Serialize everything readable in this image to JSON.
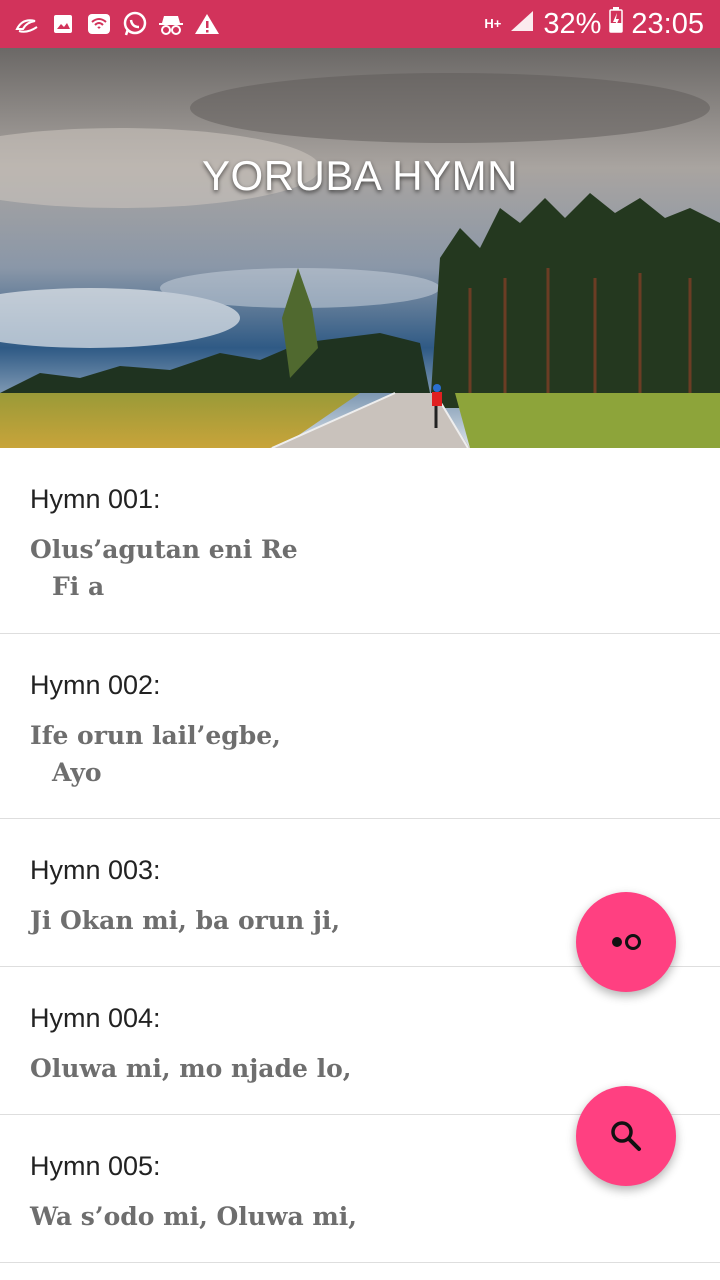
{
  "status_bar": {
    "network": "H+",
    "battery": "32%",
    "time": "23:05"
  },
  "header": {
    "title": "YORUBA HYMN"
  },
  "hymns": [
    {
      "number": "Hymn 001:",
      "line1": "Olus’agutan eni Re",
      "line2": "Fi a"
    },
    {
      "number": "Hymn 002:",
      "line1": "Ife orun lail’egbe,",
      "line2": "Ayo"
    },
    {
      "number": "Hymn 003:",
      "line1": "Ji Okan mi, ba orun ji,",
      "line2": ""
    },
    {
      "number": "Hymn 004:",
      "line1": "Oluwa mi, mo njade lo,",
      "line2": ""
    },
    {
      "number": "Hymn 005:",
      "line1": "Wa s’odo mi, Oluwa mi,",
      "line2": ""
    }
  ],
  "fabs": {
    "toggle_icon": "toggle-dots-icon",
    "search_icon": "search-icon"
  },
  "colors": {
    "status_bar": "#d2335b",
    "fab": "#ff4081"
  }
}
